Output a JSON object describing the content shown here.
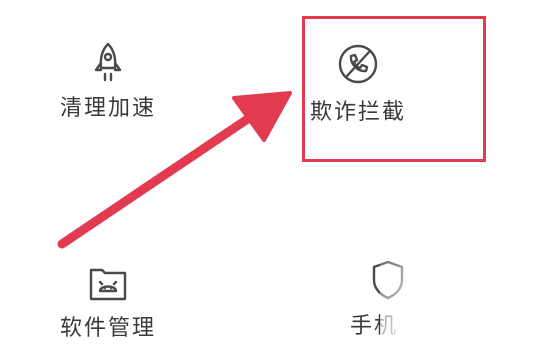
{
  "tiles": {
    "cleanup": {
      "label": "清理加速",
      "icon": "rocket-icon"
    },
    "fraud_block": {
      "label": "欺诈拦截",
      "icon": "phone-block-icon"
    },
    "software": {
      "label": "软件管理",
      "icon": "android-folder-icon"
    },
    "phone": {
      "label": "手机",
      "icon": "shield-icon"
    }
  },
  "annotation": {
    "color": "#e23a4e"
  }
}
